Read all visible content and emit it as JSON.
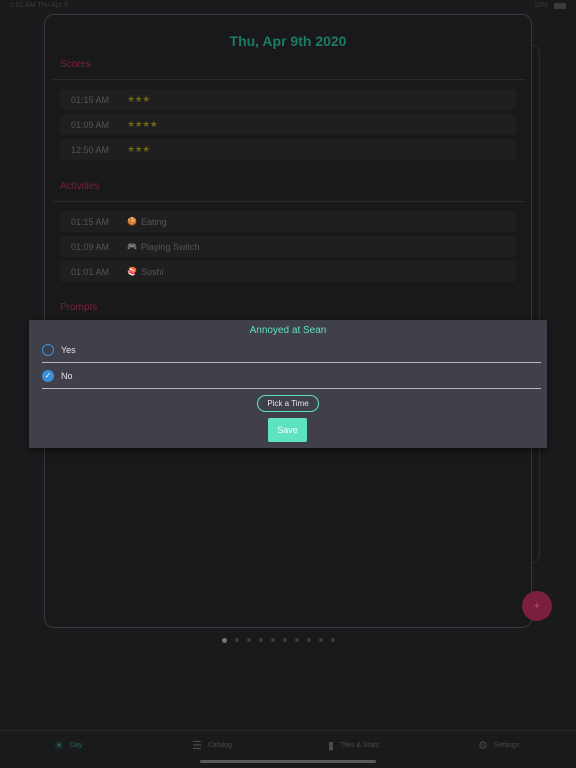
{
  "status_bar": {
    "time": "1:01 AM  Thu Apr 9",
    "battery": "10%"
  },
  "day_card": {
    "date": "Thu, Apr 9th 2020",
    "scores": {
      "title": "Scores",
      "items": [
        {
          "time": "01:15 AM",
          "stars": "★★★",
          "rating": 3
        },
        {
          "time": "01:09 AM",
          "stars": "★★★★",
          "rating": 4
        },
        {
          "time": "12:50 AM",
          "stars": "★★★",
          "rating": 3
        }
      ]
    },
    "activities": {
      "title": "Activities",
      "items": [
        {
          "time": "01:15 AM",
          "icon": "🍪",
          "label": "Eating"
        },
        {
          "time": "01:09 AM",
          "icon": "🎮",
          "label": "Playing Switch"
        },
        {
          "time": "01:01 AM",
          "icon": "🍣",
          "label": "Sushi"
        }
      ]
    },
    "prompts": {
      "title": "Prompts"
    }
  },
  "modal": {
    "title": "Annoyed at Sean",
    "options": [
      {
        "label": "Yes",
        "checked": false
      },
      {
        "label": "No",
        "checked": true
      }
    ],
    "pick_time_label": "Pick a Time",
    "save_label": "Save"
  },
  "fab": {
    "label": "+"
  },
  "pager": {
    "count": 10,
    "active": 0
  },
  "tabs": [
    {
      "label": "Day",
      "icon": "sun-icon",
      "active": true
    },
    {
      "label": "Catalog",
      "icon": "list-icon",
      "active": false
    },
    {
      "label": "Tiles & Stats",
      "icon": "bar-chart-icon",
      "active": false
    },
    {
      "label": "Settings",
      "icon": "gear-icon",
      "active": false
    }
  ],
  "colors": {
    "accent": "#5ee3c1",
    "section": "#7a1f3c",
    "radio": "#3b8fd9",
    "modal_bg": "#3f4049"
  }
}
